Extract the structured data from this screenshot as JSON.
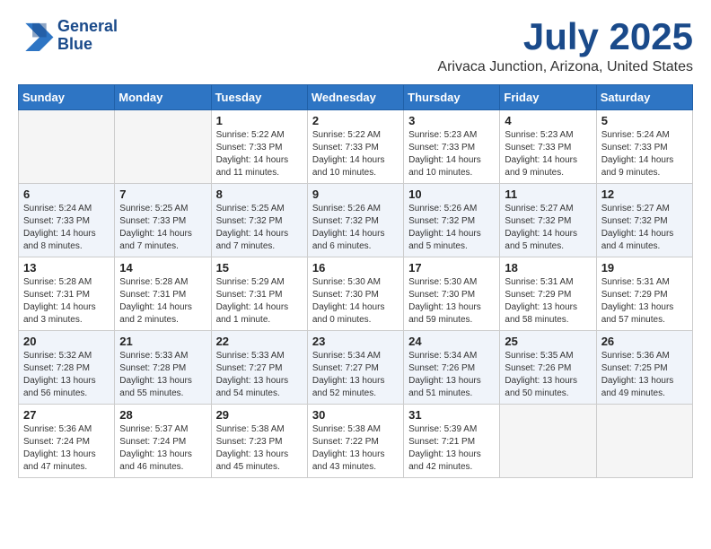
{
  "header": {
    "logo_line1": "General",
    "logo_line2": "Blue",
    "month": "July 2025",
    "location": "Arivaca Junction, Arizona, United States"
  },
  "days_of_week": [
    "Sunday",
    "Monday",
    "Tuesday",
    "Wednesday",
    "Thursday",
    "Friday",
    "Saturday"
  ],
  "weeks": [
    [
      {
        "day": "",
        "info": ""
      },
      {
        "day": "",
        "info": ""
      },
      {
        "day": "1",
        "info": "Sunrise: 5:22 AM\nSunset: 7:33 PM\nDaylight: 14 hours\nand 11 minutes."
      },
      {
        "day": "2",
        "info": "Sunrise: 5:22 AM\nSunset: 7:33 PM\nDaylight: 14 hours\nand 10 minutes."
      },
      {
        "day": "3",
        "info": "Sunrise: 5:23 AM\nSunset: 7:33 PM\nDaylight: 14 hours\nand 10 minutes."
      },
      {
        "day": "4",
        "info": "Sunrise: 5:23 AM\nSunset: 7:33 PM\nDaylight: 14 hours\nand 9 minutes."
      },
      {
        "day": "5",
        "info": "Sunrise: 5:24 AM\nSunset: 7:33 PM\nDaylight: 14 hours\nand 9 minutes."
      }
    ],
    [
      {
        "day": "6",
        "info": "Sunrise: 5:24 AM\nSunset: 7:33 PM\nDaylight: 14 hours\nand 8 minutes."
      },
      {
        "day": "7",
        "info": "Sunrise: 5:25 AM\nSunset: 7:33 PM\nDaylight: 14 hours\nand 7 minutes."
      },
      {
        "day": "8",
        "info": "Sunrise: 5:25 AM\nSunset: 7:32 PM\nDaylight: 14 hours\nand 7 minutes."
      },
      {
        "day": "9",
        "info": "Sunrise: 5:26 AM\nSunset: 7:32 PM\nDaylight: 14 hours\nand 6 minutes."
      },
      {
        "day": "10",
        "info": "Sunrise: 5:26 AM\nSunset: 7:32 PM\nDaylight: 14 hours\nand 5 minutes."
      },
      {
        "day": "11",
        "info": "Sunrise: 5:27 AM\nSunset: 7:32 PM\nDaylight: 14 hours\nand 5 minutes."
      },
      {
        "day": "12",
        "info": "Sunrise: 5:27 AM\nSunset: 7:32 PM\nDaylight: 14 hours\nand 4 minutes."
      }
    ],
    [
      {
        "day": "13",
        "info": "Sunrise: 5:28 AM\nSunset: 7:31 PM\nDaylight: 14 hours\nand 3 minutes."
      },
      {
        "day": "14",
        "info": "Sunrise: 5:28 AM\nSunset: 7:31 PM\nDaylight: 14 hours\nand 2 minutes."
      },
      {
        "day": "15",
        "info": "Sunrise: 5:29 AM\nSunset: 7:31 PM\nDaylight: 14 hours\nand 1 minute."
      },
      {
        "day": "16",
        "info": "Sunrise: 5:30 AM\nSunset: 7:30 PM\nDaylight: 14 hours\nand 0 minutes."
      },
      {
        "day": "17",
        "info": "Sunrise: 5:30 AM\nSunset: 7:30 PM\nDaylight: 13 hours\nand 59 minutes."
      },
      {
        "day": "18",
        "info": "Sunrise: 5:31 AM\nSunset: 7:29 PM\nDaylight: 13 hours\nand 58 minutes."
      },
      {
        "day": "19",
        "info": "Sunrise: 5:31 AM\nSunset: 7:29 PM\nDaylight: 13 hours\nand 57 minutes."
      }
    ],
    [
      {
        "day": "20",
        "info": "Sunrise: 5:32 AM\nSunset: 7:28 PM\nDaylight: 13 hours\nand 56 minutes."
      },
      {
        "day": "21",
        "info": "Sunrise: 5:33 AM\nSunset: 7:28 PM\nDaylight: 13 hours\nand 55 minutes."
      },
      {
        "day": "22",
        "info": "Sunrise: 5:33 AM\nSunset: 7:27 PM\nDaylight: 13 hours\nand 54 minutes."
      },
      {
        "day": "23",
        "info": "Sunrise: 5:34 AM\nSunset: 7:27 PM\nDaylight: 13 hours\nand 52 minutes."
      },
      {
        "day": "24",
        "info": "Sunrise: 5:34 AM\nSunset: 7:26 PM\nDaylight: 13 hours\nand 51 minutes."
      },
      {
        "day": "25",
        "info": "Sunrise: 5:35 AM\nSunset: 7:26 PM\nDaylight: 13 hours\nand 50 minutes."
      },
      {
        "day": "26",
        "info": "Sunrise: 5:36 AM\nSunset: 7:25 PM\nDaylight: 13 hours\nand 49 minutes."
      }
    ],
    [
      {
        "day": "27",
        "info": "Sunrise: 5:36 AM\nSunset: 7:24 PM\nDaylight: 13 hours\nand 47 minutes."
      },
      {
        "day": "28",
        "info": "Sunrise: 5:37 AM\nSunset: 7:24 PM\nDaylight: 13 hours\nand 46 minutes."
      },
      {
        "day": "29",
        "info": "Sunrise: 5:38 AM\nSunset: 7:23 PM\nDaylight: 13 hours\nand 45 minutes."
      },
      {
        "day": "30",
        "info": "Sunrise: 5:38 AM\nSunset: 7:22 PM\nDaylight: 13 hours\nand 43 minutes."
      },
      {
        "day": "31",
        "info": "Sunrise: 5:39 AM\nSunset: 7:21 PM\nDaylight: 13 hours\nand 42 minutes."
      },
      {
        "day": "",
        "info": ""
      },
      {
        "day": "",
        "info": ""
      }
    ]
  ]
}
